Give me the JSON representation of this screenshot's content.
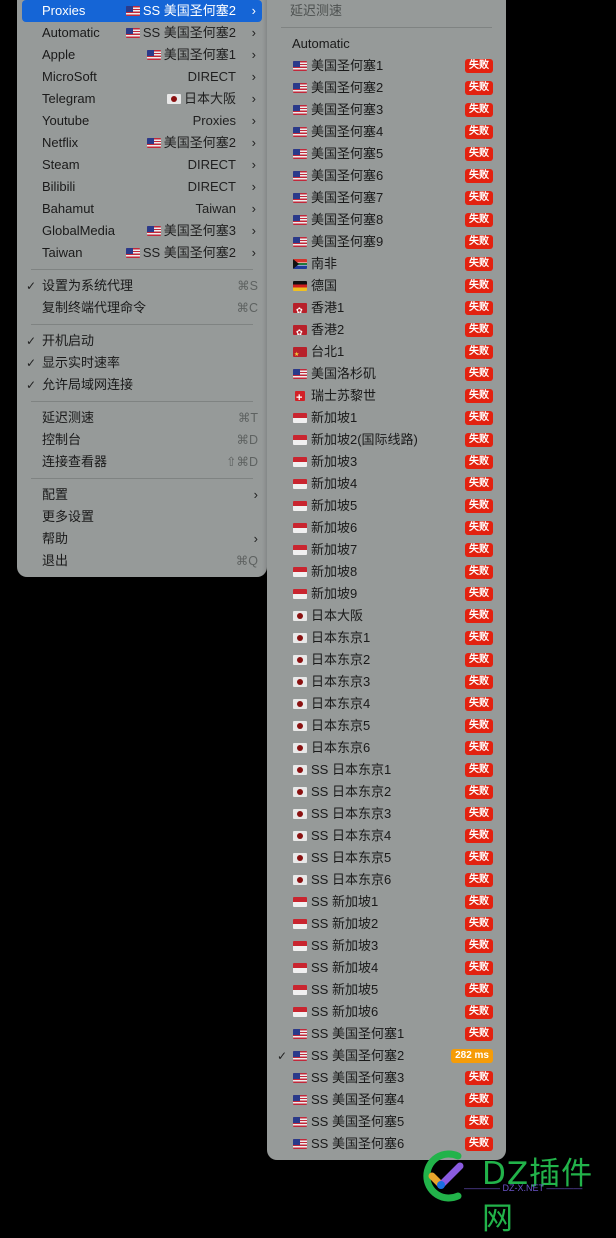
{
  "main_menu": {
    "proxy_groups": [
      {
        "name": "Proxies",
        "selected": "SS 美国圣何塞2",
        "flag": "us",
        "highlighted": true
      },
      {
        "name": "Automatic",
        "selected": "SS 美国圣何塞2",
        "flag": "us"
      },
      {
        "name": "Apple",
        "selected": "美国圣何塞1",
        "flag": "us"
      },
      {
        "name": "MicroSoft",
        "selected": "DIRECT",
        "flag": ""
      },
      {
        "name": "Telegram",
        "selected": "日本大阪",
        "flag": "jp"
      },
      {
        "name": "Youtube",
        "selected": "Proxies",
        "flag": ""
      },
      {
        "name": "Netflix",
        "selected": "美国圣何塞2",
        "flag": "us"
      },
      {
        "name": "Steam",
        "selected": "DIRECT",
        "flag": ""
      },
      {
        "name": "Bilibili",
        "selected": "DIRECT",
        "flag": ""
      },
      {
        "name": "Bahamut",
        "selected": "Taiwan",
        "flag": ""
      },
      {
        "name": "GlobalMedia",
        "selected": "美国圣何塞3",
        "flag": "us"
      },
      {
        "name": "Taiwan",
        "selected": "SS 美国圣何塞2",
        "flag": "us"
      }
    ],
    "settings_items": [
      {
        "label": "设置为系统代理",
        "checked": true,
        "shortcut": "⌘S"
      },
      {
        "label": "复制终端代理命令",
        "checked": false,
        "shortcut": "⌘C"
      }
    ],
    "toggle_items": [
      {
        "label": "开机启动",
        "checked": true
      },
      {
        "label": "显示实时速率",
        "checked": true
      },
      {
        "label": "允许局域网连接",
        "checked": true
      }
    ],
    "tool_items": [
      {
        "label": "延迟测速",
        "shortcut": "⌘T"
      },
      {
        "label": "控制台",
        "shortcut": "⌘D"
      },
      {
        "label": "连接查看器",
        "shortcut": "⇧⌘D"
      }
    ],
    "misc_items": [
      {
        "label": "配置",
        "submenu": true,
        "shortcut": ""
      },
      {
        "label": "更多设置",
        "submenu": false,
        "shortcut": ""
      },
      {
        "label": "帮助",
        "submenu": true,
        "shortcut": ""
      },
      {
        "label": "退出",
        "submenu": false,
        "shortcut": "⌘Q"
      }
    ],
    "check_glyph": "✓",
    "chevron_glyph": "›"
  },
  "sub_menu": {
    "header": "延迟测速",
    "proxies": [
      {
        "name": "Automatic",
        "flag": "",
        "status": ""
      },
      {
        "name": "美国圣何塞1",
        "flag": "us",
        "status": "失败"
      },
      {
        "name": "美国圣何塞2",
        "flag": "us",
        "status": "失败"
      },
      {
        "name": "美国圣何塞3",
        "flag": "us",
        "status": "失败"
      },
      {
        "name": "美国圣何塞4",
        "flag": "us",
        "status": "失败"
      },
      {
        "name": "美国圣何塞5",
        "flag": "us",
        "status": "失败"
      },
      {
        "name": "美国圣何塞6",
        "flag": "us",
        "status": "失败"
      },
      {
        "name": "美国圣何塞7",
        "flag": "us",
        "status": "失败"
      },
      {
        "name": "美国圣何塞8",
        "flag": "us",
        "status": "失败"
      },
      {
        "name": "美国圣何塞9",
        "flag": "us",
        "status": "失败"
      },
      {
        "name": "南非",
        "flag": "za",
        "status": "失败"
      },
      {
        "name": "德国",
        "flag": "de",
        "status": "失败"
      },
      {
        "name": "香港1",
        "flag": "hk",
        "status": "失败"
      },
      {
        "name": "香港2",
        "flag": "hk",
        "status": "失败"
      },
      {
        "name": "台北1",
        "flag": "cn",
        "status": "失败"
      },
      {
        "name": "美国洛杉矶",
        "flag": "us",
        "status": "失败"
      },
      {
        "name": "瑞士苏黎世",
        "flag": "ch",
        "status": "失败"
      },
      {
        "name": "新加坡1",
        "flag": "sg",
        "status": "失败"
      },
      {
        "name": " 新加坡2(国际线路)",
        "flag": "sg",
        "status": "失败"
      },
      {
        "name": "新加坡3",
        "flag": "sg",
        "status": "失败"
      },
      {
        "name": "新加坡4",
        "flag": "sg",
        "status": "失败"
      },
      {
        "name": "新加坡5",
        "flag": "sg",
        "status": "失败"
      },
      {
        "name": "新加坡6",
        "flag": "sg",
        "status": "失败"
      },
      {
        "name": "新加坡7",
        "flag": "sg",
        "status": "失败"
      },
      {
        "name": "新加坡8",
        "flag": "sg",
        "status": "失败"
      },
      {
        "name": "新加坡9",
        "flag": "sg",
        "status": "失败"
      },
      {
        "name": "日本大阪",
        "flag": "jp",
        "status": "失败"
      },
      {
        "name": "日本东京1",
        "flag": "jp",
        "status": "失败"
      },
      {
        "name": "日本东京2",
        "flag": "jp",
        "status": "失败"
      },
      {
        "name": "日本东京3",
        "flag": "jp",
        "status": "失败"
      },
      {
        "name": "日本东京4",
        "flag": "jp",
        "status": "失败"
      },
      {
        "name": "日本东京5",
        "flag": "jp",
        "status": "失败"
      },
      {
        "name": "日本东京6",
        "flag": "jp",
        "status": "失败"
      },
      {
        "name": "SS 日本东京1",
        "flag": "jp",
        "status": "失败"
      },
      {
        "name": "SS 日本东京2",
        "flag": "jp",
        "status": "失败"
      },
      {
        "name": "SS 日本东京3",
        "flag": "jp",
        "status": "失败"
      },
      {
        "name": "SS 日本东京4",
        "flag": "jp",
        "status": "失败"
      },
      {
        "name": "SS 日本东京5",
        "flag": "jp",
        "status": "失败"
      },
      {
        "name": "SS 日本东京6",
        "flag": "jp",
        "status": "失败"
      },
      {
        "name": "SS 新加坡1",
        "flag": "sg",
        "status": "失败"
      },
      {
        "name": "SS 新加坡2",
        "flag": "sg",
        "status": "失败"
      },
      {
        "name": "SS 新加坡3",
        "flag": "sg",
        "status": "失败"
      },
      {
        "name": "SS 新加坡4",
        "flag": "sg",
        "status": "失败"
      },
      {
        "name": "SS 新加坡5",
        "flag": "sg",
        "status": "失败"
      },
      {
        "name": "SS 新加坡6",
        "flag": "sg",
        "status": "失败"
      },
      {
        "name": "SS 美国圣何塞1",
        "flag": "us",
        "status": "失败"
      },
      {
        "name": "SS 美国圣何塞2",
        "flag": "us",
        "status": "282 ms",
        "checked": true,
        "ok": true
      },
      {
        "name": "SS 美国圣何塞3",
        "flag": "us",
        "status": "失败"
      },
      {
        "name": "SS 美国圣何塞4",
        "flag": "us",
        "status": "失败"
      },
      {
        "name": "SS 美国圣何塞5",
        "flag": "us",
        "status": "失败"
      },
      {
        "name": "SS 美国圣何塞6",
        "flag": "us",
        "status": "失败"
      }
    ]
  },
  "watermark": {
    "title": "DZ插件网",
    "subtitle": "———— DZ-X.NET ————"
  },
  "colors": {
    "menu_bg": "#969a99",
    "highlight": "#1565d6",
    "fail_badge": "#e3210f",
    "ok_badge": "#f59c08"
  }
}
